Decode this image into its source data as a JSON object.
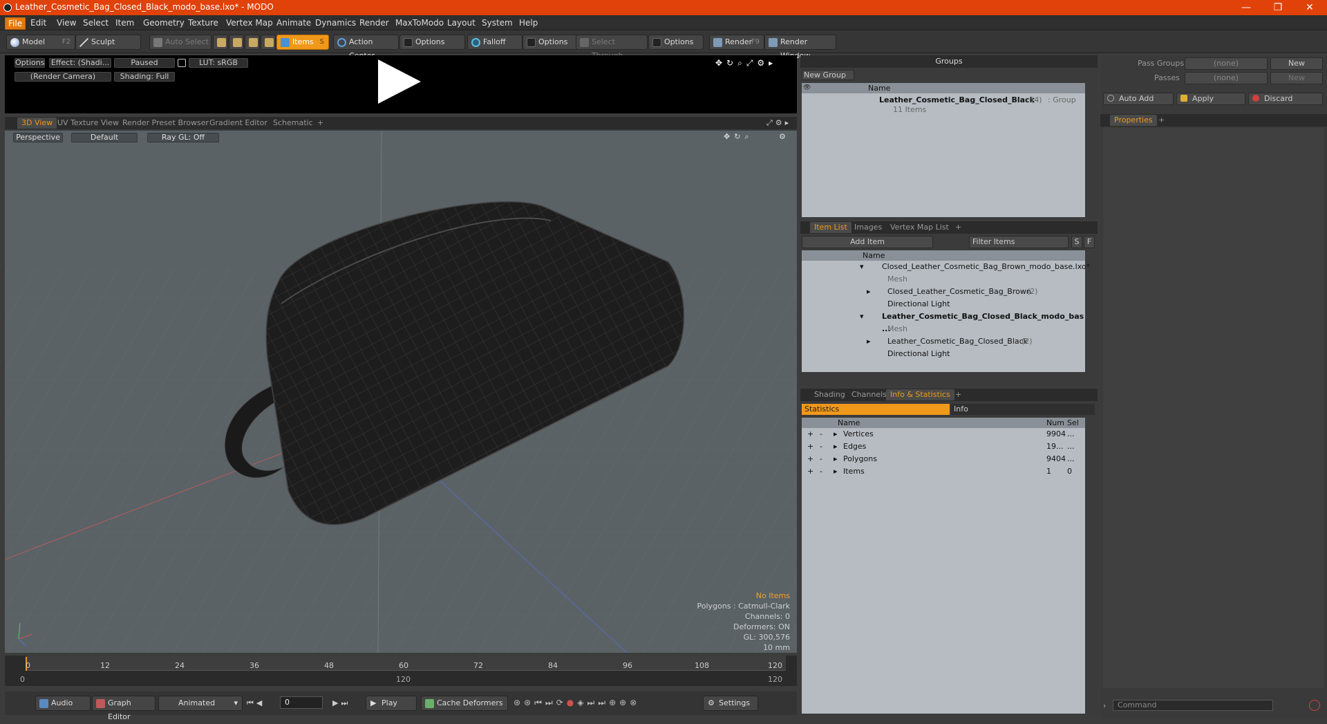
{
  "window": {
    "title": "Leather_Cosmetic_Bag_Closed_Black_modo_base.lxo* - MODO",
    "minimize": "—",
    "maximize": "❐",
    "close": "✕"
  },
  "menu": [
    "File",
    "Edit",
    "View",
    "Select",
    "Item",
    "Geometry",
    "Texture",
    "Vertex Map",
    "Animate",
    "Dynamics",
    "Render",
    "MaxToModo",
    "Layout",
    "System",
    "Help"
  ],
  "toolbar": {
    "model": "Model",
    "model_key": "F2",
    "sculpt": "Sculpt",
    "auto_select": "Auto Select",
    "items": "Items",
    "items_key": "S",
    "action_center": "Action Center",
    "options1": "Options",
    "falloff": "Falloff",
    "options2": "Options",
    "select_through": "Select Through",
    "options3": "Options",
    "render": "Render",
    "render_key": "F9",
    "render_window": "Render Window"
  },
  "preview": {
    "options": "Options",
    "effect": "Effect: (Shadi...",
    "paused": "Paused",
    "lut": "LUT: sRGB",
    "camera": "(Render Camera)",
    "shading": "Shading: Full"
  },
  "viewport_tabs": [
    "3D View",
    "UV Texture View",
    "Render Preset Browser",
    "Gradient Editor",
    "Schematic",
    "+"
  ],
  "viewport": {
    "perspective": "Perspective",
    "default": "Default",
    "raygl": "Ray GL: Off",
    "hud": {
      "no_items": "No Items",
      "polygons": "Polygons : Catmull-Clark",
      "channels": "Channels: 0",
      "deformers": "Deformers: ON",
      "gl": "GL: 300,576",
      "scale": "10 mm"
    }
  },
  "timeline": {
    "ticks": [
      "0",
      "12",
      "24",
      "36",
      "48",
      "60",
      "72",
      "84",
      "96",
      "108",
      "120"
    ],
    "start": "0",
    "mid": "120",
    "end": "120"
  },
  "transport": {
    "audio": "Audio",
    "graph_editor": "Graph Editor",
    "animated": "Animated",
    "frame": "0",
    "play": "Play",
    "cache_deformers": "Cache Deformers",
    "settings": "Settings"
  },
  "groups": {
    "header": "Groups",
    "new_group": "New Group",
    "col_name": "Name",
    "group_name": "Leather_Cosmetic_Bag_Closed_Black",
    "group_count": "(4)",
    "group_type": ": Group",
    "group_items": "11 Items"
  },
  "itemlist": {
    "tabs": [
      "Item List",
      "Images",
      "Vertex Map List",
      "+"
    ],
    "add_item": "Add Item",
    "filter": "Filter Items",
    "s": "S",
    "f": "F",
    "col_name": "Name",
    "rows": [
      {
        "label": "Closed_Leather_Cosmetic_Bag_Brown_modo_base.lxo*",
        "count": ""
      },
      {
        "label": "Mesh",
        "count": ""
      },
      {
        "label": "Closed_Leather_Cosmetic_Bag_Brown",
        "count": "(2)"
      },
      {
        "label": "Directional Light",
        "count": ""
      },
      {
        "label": "Leather_Cosmetic_Bag_Closed_Black_modo_bas ...",
        "count": ""
      },
      {
        "label": "Mesh",
        "count": ""
      },
      {
        "label": "Leather_Cosmetic_Bag_Closed_Black",
        "count": "(2)"
      },
      {
        "label": "Directional Light",
        "count": ""
      }
    ]
  },
  "stats": {
    "tabs": [
      "Shading",
      "Channels",
      "Info & Statistics",
      "+"
    ],
    "statistics": "Statistics",
    "info": "Info",
    "col_name": "Name",
    "col_num": "Num",
    "col_sel": "Sel",
    "rows": [
      {
        "name": "Vertices",
        "num": "9904",
        "sel": "..."
      },
      {
        "name": "Edges",
        "num": "19...",
        "sel": "..."
      },
      {
        "name": "Polygons",
        "num": "9404",
        "sel": "..."
      },
      {
        "name": "Items",
        "num": "1",
        "sel": "0"
      }
    ]
  },
  "props": {
    "pass_groups": "Pass Groups",
    "passes": "Passes",
    "none1": "(none)",
    "none2": "(none)",
    "new1": "New",
    "new2": "New",
    "auto_add": "Auto Add",
    "apply": "Apply",
    "discard": "Discard",
    "properties": "Properties",
    "plus": "+",
    "command": "Command"
  },
  "colors": {
    "accent": "#f0981a",
    "titlebar": "#e0420a",
    "viewport": "#5a6266"
  }
}
